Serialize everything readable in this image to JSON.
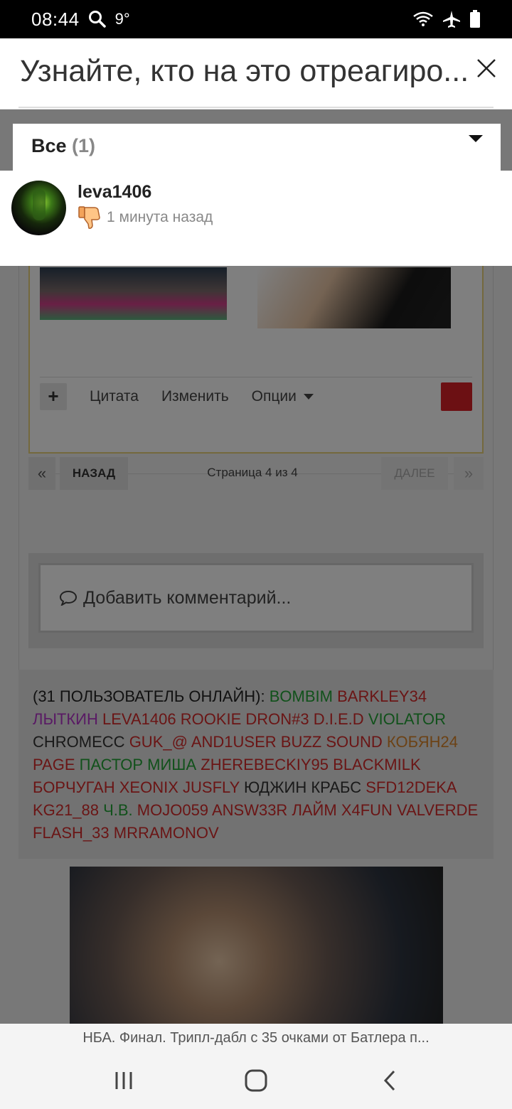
{
  "status_bar": {
    "time": "08:44",
    "temperature": "9°",
    "icons": [
      "search-icon",
      "wifi-icon",
      "airplane-icon",
      "battery-icon"
    ]
  },
  "modal": {
    "title": "Узнайте, кто на это отреагиро...",
    "filter": {
      "label": "Все",
      "count": "(1)"
    },
    "reactions": [
      {
        "username": "leva1406",
        "reaction": "thumbs-down-icon",
        "time": "1 минута назад"
      }
    ]
  },
  "post_actions": {
    "add_label": "+",
    "quote": "Цитата",
    "edit": "Изменить",
    "options": "Опции"
  },
  "pagination": {
    "first": "«",
    "prev": "НАЗАД",
    "info": "Страница 4 из 4",
    "next": "ДАЛЕЕ",
    "last": "»"
  },
  "comment": {
    "placeholder": "Добавить комментарий..."
  },
  "online": {
    "count": "(31 ПОЛЬЗОВАТЕЛЬ ОНЛАЙН):",
    "users": [
      {
        "name": "BOMBIM",
        "color": "green"
      },
      {
        "name": "BARKLEY34",
        "color": "red"
      },
      {
        "name": "ЛЫТКИН",
        "color": "purple"
      },
      {
        "name": "LEVA1406",
        "color": "red"
      },
      {
        "name": "ROOKIE",
        "color": "red"
      },
      {
        "name": "DRON#3",
        "color": "red"
      },
      {
        "name": "D.I.E.D",
        "color": "red"
      },
      {
        "name": "VIOLATOR",
        "color": "green"
      },
      {
        "name": "CHROMECC",
        "color": "dark"
      },
      {
        "name": "GUK_@",
        "color": "red"
      },
      {
        "name": "AND1USER",
        "color": "red"
      },
      {
        "name": "BUZZ SOUND",
        "color": "red"
      },
      {
        "name": "КОБЯН24",
        "color": "orange"
      },
      {
        "name": "PAGE",
        "color": "red"
      },
      {
        "name": "ПАСТОР",
        "color": "green"
      },
      {
        "name": "МИША",
        "color": "green"
      },
      {
        "name": "ZHEREBECKIY95",
        "color": "red"
      },
      {
        "name": "BLACKMILK",
        "color": "red"
      },
      {
        "name": "БОРЧУГАН",
        "color": "red"
      },
      {
        "name": "XEONIX",
        "color": "red"
      },
      {
        "name": "JUSFLY",
        "color": "red"
      },
      {
        "name": "ЮДЖИН КРАБС",
        "color": "dark"
      },
      {
        "name": "SFD12DEKA",
        "color": "red"
      },
      {
        "name": "KG21_88",
        "color": "red"
      },
      {
        "name": "Ч.В.",
        "color": "green"
      },
      {
        "name": "MOJO059",
        "color": "red"
      },
      {
        "name": "ANSW33R",
        "color": "red"
      },
      {
        "name": "ЛАЙМ",
        "color": "red"
      },
      {
        "name": "X4FUN",
        "color": "red"
      },
      {
        "name": "VALVERDE",
        "color": "red"
      },
      {
        "name": "FLASH_33",
        "color": "red"
      },
      {
        "name": "MRRAMONOV",
        "color": "red"
      }
    ]
  },
  "headline": "НБА. Финал. Трипл-дабл с 35 очками от Батлера п...",
  "colors": {
    "accent_red": "#d92027",
    "user_green": "#23a336",
    "user_red": "#d52b2b",
    "user_purple": "#b234c9",
    "user_orange": "#d9852b"
  }
}
